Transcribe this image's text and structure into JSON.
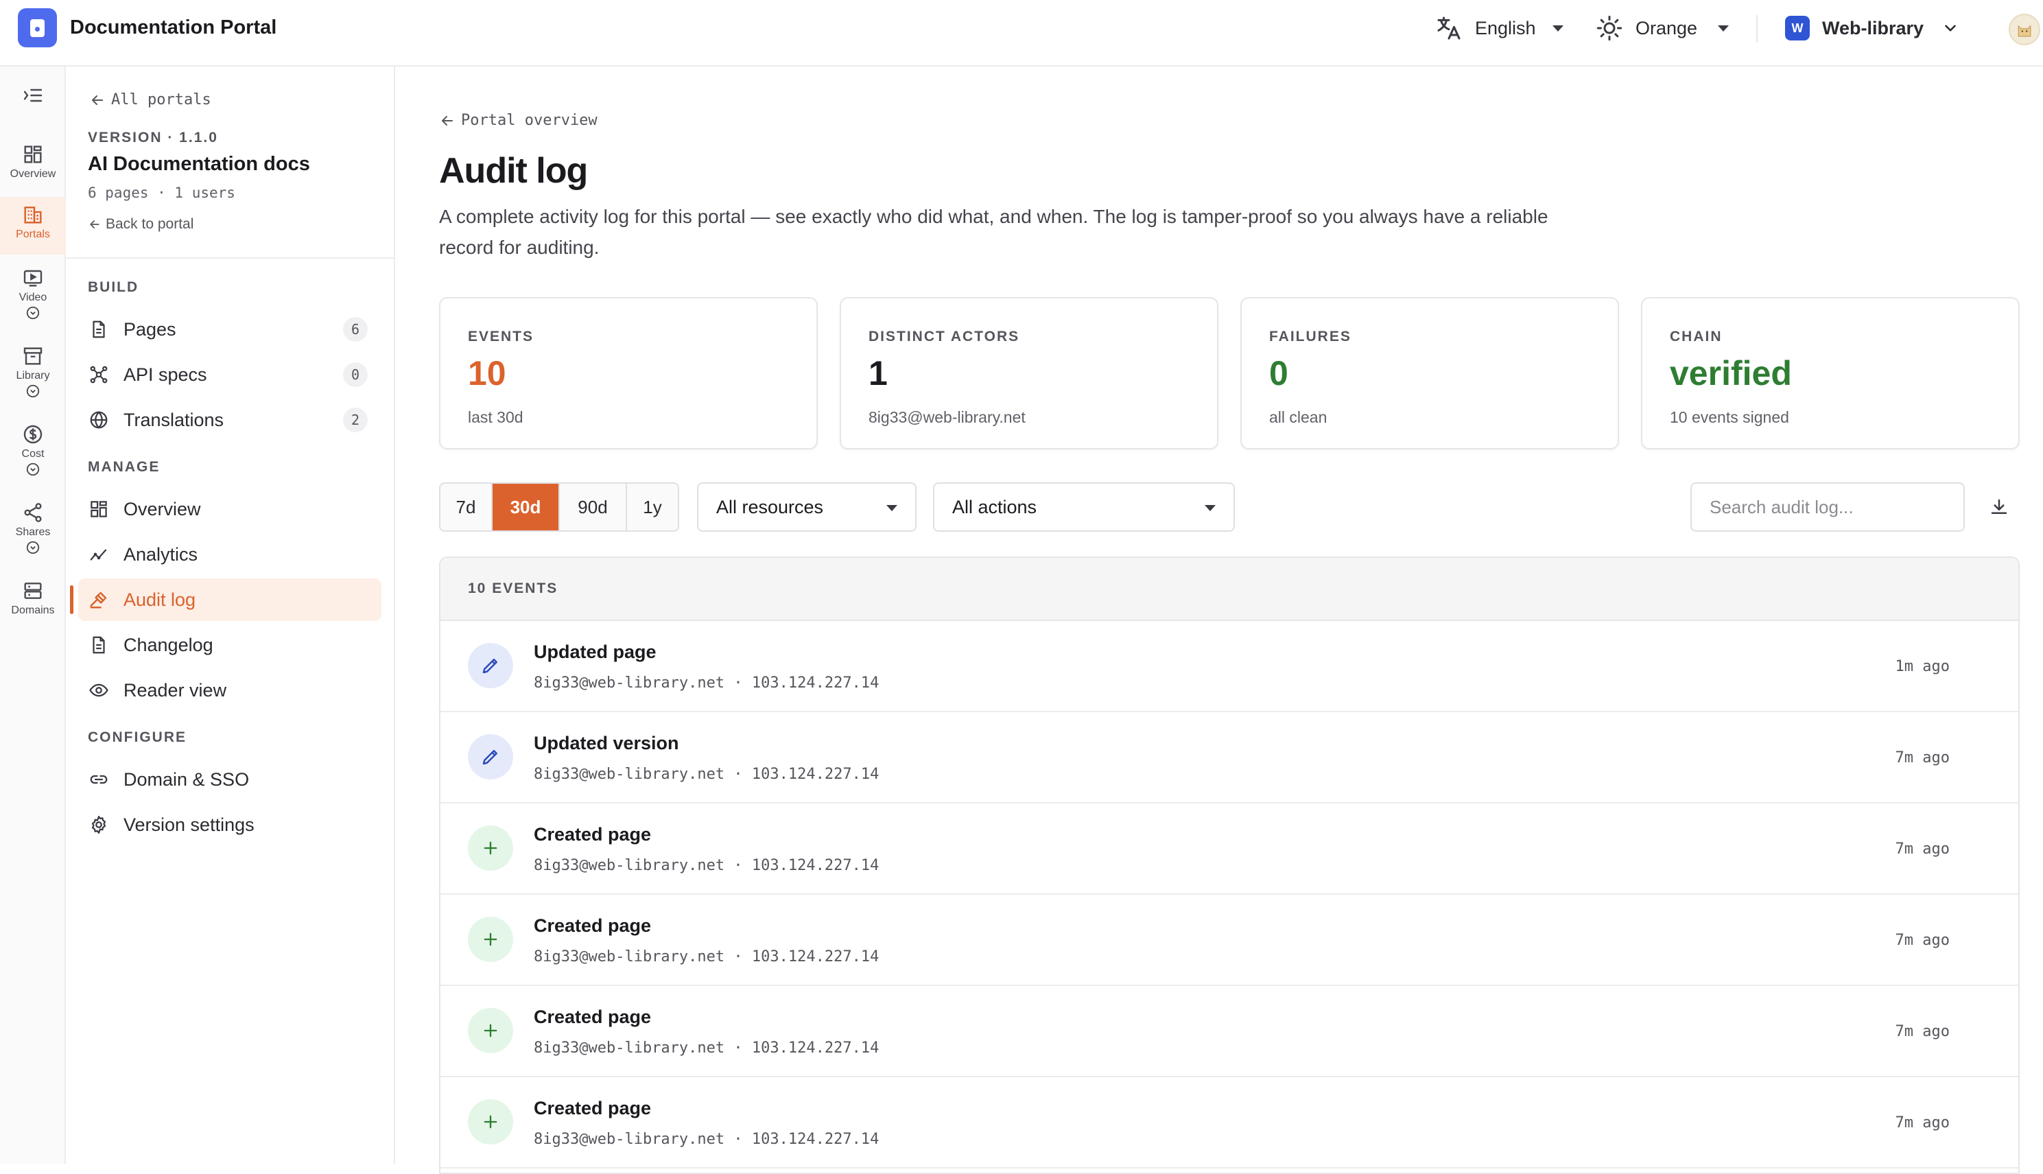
{
  "app": {
    "title": "Documentation Portal",
    "language": "English",
    "theme": "Orange",
    "workspace_badge": "W",
    "workspace": "Web-library"
  },
  "colors": {
    "accent": "#dc622d",
    "success": "#2e7d32",
    "brand": "#4f6bed"
  },
  "rail": [
    {
      "label": "Overview",
      "icon": "grid-icon"
    },
    {
      "label": "Portals",
      "icon": "building-icon",
      "active": true
    },
    {
      "label": "Video",
      "icon": "video-icon"
    },
    {
      "label": "Library",
      "icon": "archive-icon"
    },
    {
      "label": "Cost",
      "icon": "dollar-icon"
    },
    {
      "label": "Shares",
      "icon": "share-icon"
    },
    {
      "label": "Domains",
      "icon": "server-icon"
    }
  ],
  "sidebar": {
    "back_label": "All portals",
    "version_label": "VERSION · 1.1.0",
    "project_name": "AI Documentation docs",
    "project_meta": "6 pages · 1 users",
    "back_to_portal": "Back to portal",
    "sections": [
      {
        "heading": "BUILD",
        "items": [
          {
            "label": "Pages",
            "count": "6",
            "icon": "document-icon"
          },
          {
            "label": "API specs",
            "count": "0",
            "icon": "api-icon"
          },
          {
            "label": "Translations",
            "count": "2",
            "icon": "globe-icon"
          }
        ]
      },
      {
        "heading": "MANAGE",
        "items": [
          {
            "label": "Overview",
            "icon": "grid-icon"
          },
          {
            "label": "Analytics",
            "icon": "analytics-icon"
          },
          {
            "label": "Audit log",
            "icon": "gavel-icon",
            "active": true
          },
          {
            "label": "Changelog",
            "icon": "document-icon"
          },
          {
            "label": "Reader view",
            "icon": "eye-icon"
          }
        ]
      },
      {
        "heading": "CONFIGURE",
        "items": [
          {
            "label": "Domain & SSO",
            "icon": "link-icon"
          },
          {
            "label": "Version settings",
            "icon": "gear-icon"
          }
        ]
      }
    ]
  },
  "main": {
    "breadcrumb": "Portal overview",
    "title": "Audit log",
    "description": "A complete activity log for this portal — see exactly who did what, and when. The log is tamper-proof so you always have a reliable record for auditing.",
    "stats": [
      {
        "key": "EVENTS",
        "value": "10",
        "sub": "last 30d",
        "color": "#dc622d"
      },
      {
        "key": "DISTINCT ACTORS",
        "value": "1",
        "sub": "8ig33@web-library.net",
        "color": "#1b1b1f"
      },
      {
        "key": "FAILURES",
        "value": "0",
        "sub": "all clean",
        "color": "#2e7d32"
      },
      {
        "key": "CHAIN",
        "value": "verified",
        "sub": "10 events signed",
        "color": "#2e7d32"
      }
    ],
    "ranges": [
      "7d",
      "30d",
      "90d",
      "1y"
    ],
    "active_range": "30d",
    "resource_filter": "All resources",
    "action_filter": "All actions",
    "search_placeholder": "Search audit log...",
    "log_header": "10 EVENTS",
    "events": [
      {
        "title": "Updated page",
        "actor": "8ig33@web-library.net",
        "ip": "103.124.227.14",
        "time": "1m ago",
        "kind": "edit"
      },
      {
        "title": "Updated version",
        "actor": "8ig33@web-library.net",
        "ip": "103.124.227.14",
        "time": "7m ago",
        "kind": "edit"
      },
      {
        "title": "Created page",
        "actor": "8ig33@web-library.net",
        "ip": "103.124.227.14",
        "time": "7m ago",
        "kind": "add"
      },
      {
        "title": "Created page",
        "actor": "8ig33@web-library.net",
        "ip": "103.124.227.14",
        "time": "7m ago",
        "kind": "add"
      },
      {
        "title": "Created page",
        "actor": "8ig33@web-library.net",
        "ip": "103.124.227.14",
        "time": "7m ago",
        "kind": "add"
      },
      {
        "title": "Created page",
        "actor": "8ig33@web-library.net",
        "ip": "103.124.227.14",
        "time": "7m ago",
        "kind": "add"
      }
    ]
  }
}
